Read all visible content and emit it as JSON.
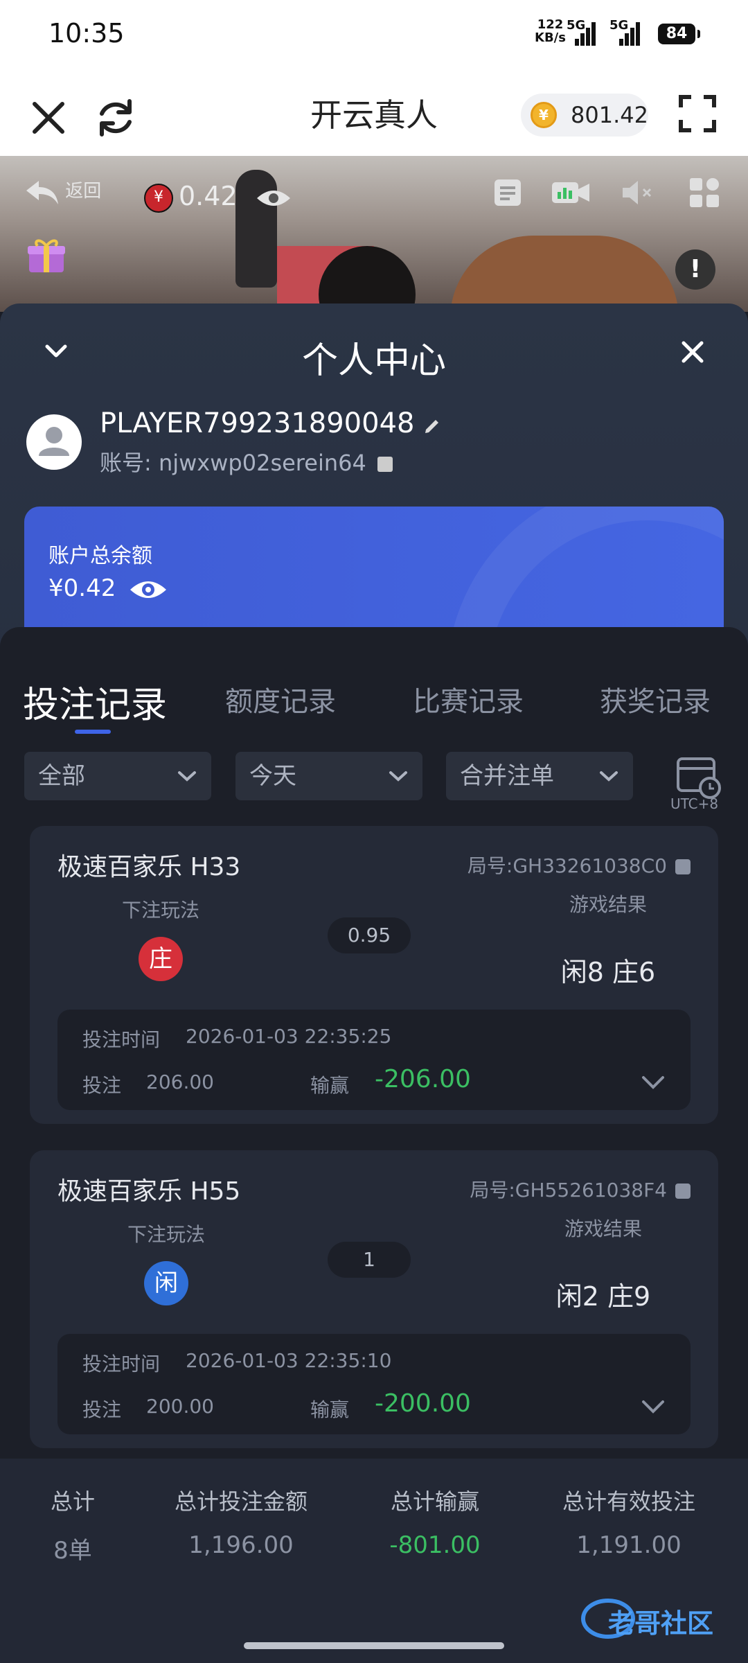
{
  "status_bar": {
    "time": "10:35",
    "net_speed": "122",
    "net_unit": "KB/s",
    "net1": "5G",
    "net2": "5G",
    "battery": "84"
  },
  "app_header": {
    "title": "开云真人",
    "balance": "801.42"
  },
  "video_bar": {
    "back_label": "返回",
    "balance": "0.42",
    "currency_symbol": "¥"
  },
  "panel": {
    "title": "个人中心",
    "username": "PLAYER799231890048",
    "account": "账号: njwxwp02serein64",
    "balance_label": "账户总余额",
    "balance_value": "¥0.42"
  },
  "tabs": [
    "投注记录",
    "额度记录",
    "比赛记录",
    "获奖记录"
  ],
  "filters": {
    "type": "全部",
    "date": "今天",
    "merge": "合并注单",
    "timezone": "UTC+8"
  },
  "records": [
    {
      "game": "极速百家乐 H33",
      "round": "局号:GH33261038C0",
      "play_label": "下注玩法",
      "play": "庄",
      "play_color": "#d6303a",
      "odds": "0.95",
      "result_label": "游戏结果",
      "result": "闲8 庄6",
      "time_label": "投注时间",
      "time": "2026-01-03 22:35:25",
      "bet_label": "投注",
      "bet": "206.00",
      "win_label": "输赢",
      "win": "-206.00"
    },
    {
      "game": "极速百家乐 H55",
      "round": "局号:GH55261038F4",
      "play_label": "下注玩法",
      "play": "闲",
      "play_color": "#2f6fd8",
      "odds": "1",
      "result_label": "游戏结果",
      "result": "闲2 庄9",
      "time_label": "投注时间",
      "time": "2026-01-03 22:35:10",
      "bet_label": "投注",
      "bet": "200.00",
      "win_label": "输赢",
      "win": "-200.00"
    }
  ],
  "summary": {
    "total_label": "总计",
    "total_value": "8单",
    "amount_label": "总计投注金额",
    "amount_value": "1,196.00",
    "winloss_label": "总计输赢",
    "winloss_value": "-801.00",
    "valid_label": "总计有效投注",
    "valid_value": "1,191.00"
  },
  "watermark": "老哥社区",
  "colors": {
    "accent": "#3e64e8",
    "win_loss": "#3bbf63",
    "banker": "#d6303a",
    "player": "#2f6fd8"
  }
}
